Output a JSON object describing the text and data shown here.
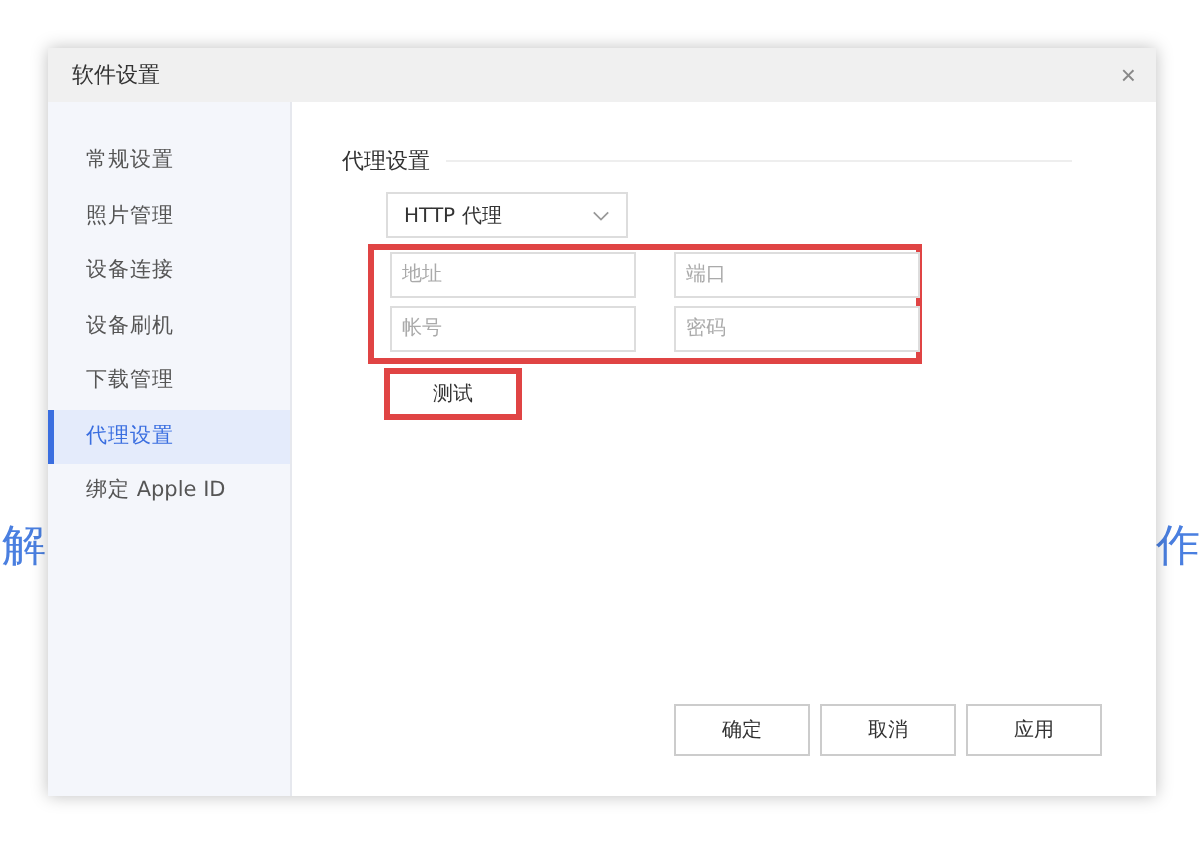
{
  "background": {
    "left_text": "解",
    "right_text": "作"
  },
  "window": {
    "title": "软件设置",
    "close": "×"
  },
  "sidebar": {
    "items": [
      {
        "label": "常规设置",
        "selected": false
      },
      {
        "label": "照片管理",
        "selected": false
      },
      {
        "label": "设备连接",
        "selected": false
      },
      {
        "label": "设备刷机",
        "selected": false
      },
      {
        "label": "下载管理",
        "selected": false
      },
      {
        "label": "代理设置",
        "selected": true
      },
      {
        "label": "绑定 Apple ID",
        "selected": false
      }
    ]
  },
  "proxy": {
    "heading": "代理设置",
    "type_select": {
      "value": "HTTP 代理"
    },
    "fields_highlighted": true,
    "fields": [
      {
        "placeholder": "地址"
      },
      {
        "placeholder": "端口"
      },
      {
        "placeholder": "帐号"
      },
      {
        "placeholder": "密码"
      }
    ],
    "test_button": {
      "label": "测试",
      "highlighted": true
    }
  },
  "buttons": [
    "确定",
    "取消",
    "应用"
  ]
}
